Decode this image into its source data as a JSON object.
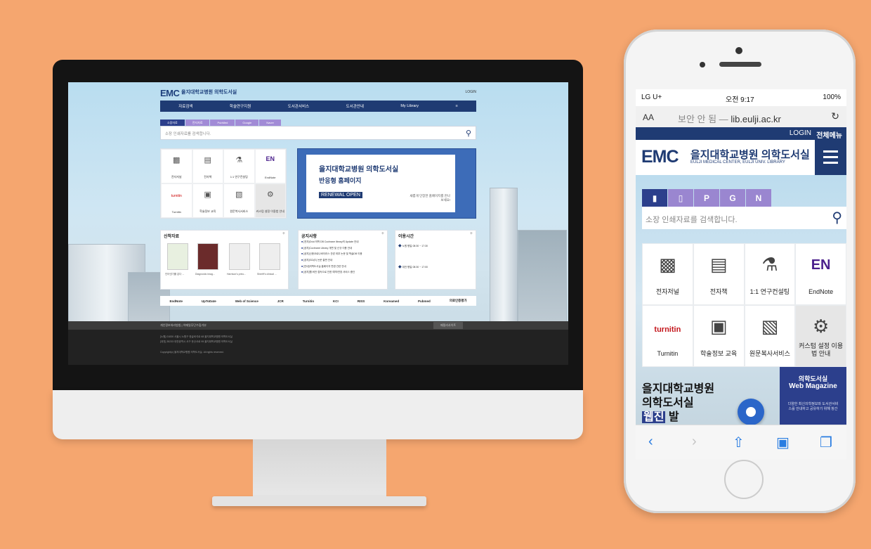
{
  "desktop": {
    "logo": "EMC",
    "logo_text": "을지대학교병원 의학도서실",
    "login": "LOGIN",
    "nav": [
      "자료검색",
      "학술연구지원",
      "도서관서비스",
      "도서관안내",
      "My Library"
    ],
    "tabs": [
      "소장자료",
      "전자자료",
      "PubMed",
      "Google",
      "Naver"
    ],
    "search_placeholder": "소장 인쇄자료를 검색합니다.",
    "quick": [
      "전자저널",
      "전자책",
      "1:1 연구컨설팅",
      "EndNote",
      "Turnitin",
      "학술정보 교육",
      "원문복사서비스",
      "커스텀 설정 이용법 안내"
    ],
    "quick_icon_en": "EN",
    "quick_icon_turnitin": "turnitin",
    "banner": {
      "title1": "을지대학교병원 의학도서실",
      "title2": "반응형 홈페이지",
      "badge": "RENEWAL OPEN",
      "desc": "새롭게 단장한 홈페이지를 만나보세요!"
    },
    "new_books_title": "신착자료",
    "book_captions": [
      "인터넷기를 분다 ...",
      "Diagnostic imag...",
      "Harrison's princ...",
      "Sheriff's clinical ..."
    ],
    "notice_title": "공지사항",
    "notices": [
      "[전자]Ovid 의학 DB Cochrane library의 Update 안내",
      "[공지]Cochrane Library 개편 및 신규 이용 안내",
      "[공지]신종코로나바이러스 관련 외부 논문 및 학술DB 이용",
      "[공지]SCI(E) 논문 출판 안내",
      "[안내]의학도서실 홈페이지 변경 관련 안내",
      "[공지]웹 버전 접속으로 인한 예약/연장 서비스 중단"
    ],
    "hours_title": "이용시간",
    "hours": [
      {
        "place": "노원",
        "days": "평일",
        "time": "08:30 ~ 17:30"
      },
      {
        "place": "대전",
        "days": "평일",
        "time": "08:30 ~ 17:00"
      }
    ],
    "links": [
      "EndNote",
      "UpToDate",
      "Web of Science",
      "JCR",
      "Turnitin",
      "KCI",
      "RISS",
      "Koreamed",
      "Pubmed",
      "의료인증평가"
    ],
    "footer_links": "개인정보처리방침 | 이메일무단수집거부",
    "family_site": "패밀리사이트",
    "footer_addr": "[노원] 01830 서울시 노원구 한글비석로 68 을지대학교병원 의학도서실",
    "footer_addr2": "[대전] 35233 대전광역시 서구 둔산서로 95 을지대학교병원 의학도서실",
    "copyright": "Copyright(c) 을지대학교병원 의학도서실. All rights reserved."
  },
  "phone": {
    "carrier": "LG U+",
    "time": "오전 9:17",
    "battery": "100%",
    "aa": "AA",
    "url_insecure": "보안 안 됨 —",
    "url": "lib.eulji.ac.kr",
    "login": "LOGIN",
    "all_menu": "전체메뉴",
    "logo": "EMC",
    "logo_text": "을지대학교병원 의학도서실",
    "logo_sub": "EULJI MEDICAL CENTER, EULJI UNIV. LIBRARY",
    "tabs": [
      "",
      "",
      "P",
      "G",
      "N"
    ],
    "search_placeholder": "소장 인쇄자료를 검색합니다.",
    "quick": [
      "전자저널",
      "전자책",
      "1:1 연구컨설팅",
      "EndNote",
      "Turnitin",
      "학술정보 교육",
      "원문복사서비스",
      "커스텀 설정 이용법 안내"
    ],
    "quick_icon_en": "EN",
    "quick_icon_turnitin": "turnitin",
    "promo": {
      "line1": "을지대학교병원",
      "line2": "의학도서실",
      "line3_highlight": "웹진",
      "line3_rest": " 발",
      "right1": "의학도서실",
      "right2": "Web Magazine",
      "right3": "다양한 최신의학정보와 도서관서비스를 안내하고 공유하기 위해 창간"
    }
  },
  "colors": {
    "background": "#f5a66f",
    "navy": "#1f3b73",
    "tab_purple": "#9a86d0",
    "accent_blue": "#2b66c9"
  }
}
